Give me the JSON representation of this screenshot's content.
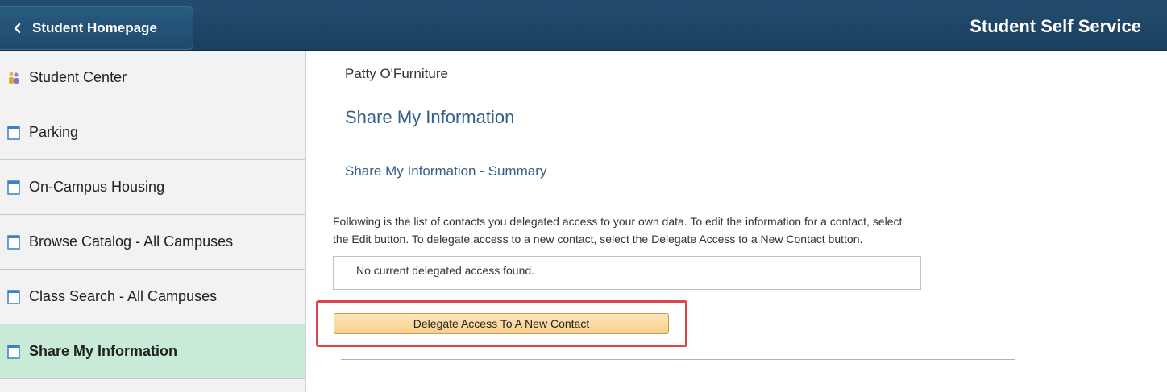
{
  "header": {
    "back_label": "Student Homepage",
    "app_title": "Student Self Service"
  },
  "sidebar": {
    "items": [
      {
        "label": "Student Center",
        "icon": "student-center-icon",
        "active": false
      },
      {
        "label": "Parking",
        "icon": "page-icon",
        "active": false
      },
      {
        "label": "On-Campus Housing",
        "icon": "page-icon",
        "active": false
      },
      {
        "label": "Browse Catalog - All Campuses",
        "icon": "page-icon",
        "active": false
      },
      {
        "label": "Class Search - All Campuses",
        "icon": "page-icon",
        "active": false
      },
      {
        "label": "Share My Information",
        "icon": "page-icon",
        "active": true
      }
    ]
  },
  "main": {
    "user_name": "Patty O'Furniture",
    "page_title": "Share My Information",
    "section_title": "Share My Information - Summary",
    "instructions_line1": "Following is the list of contacts you delegated access to your own data. To edit the information for a contact, select",
    "instructions_line2": "the Edit button. To delegate access to a new contact, select the Delegate Access to a New Contact button.",
    "empty_message": "No current delegated access found.",
    "delegate_button_label": "Delegate Access To A New Contact"
  },
  "colors": {
    "header_bg": "#1f4a6c",
    "link_blue": "#33608a",
    "active_nav": "#c9ead7",
    "button_orange": "#f8cf8a",
    "highlight_red": "#e0454a"
  }
}
